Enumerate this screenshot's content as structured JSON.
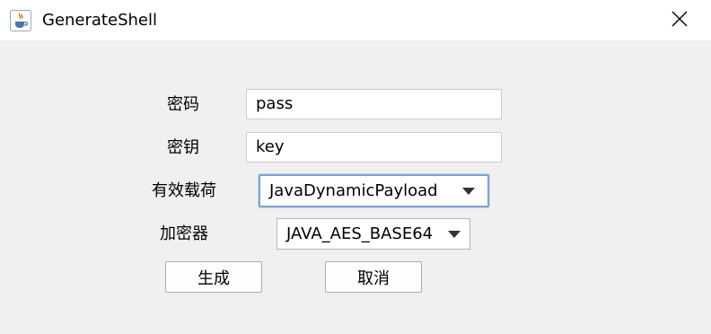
{
  "window": {
    "title": "GenerateShell",
    "icon": "java-cup-icon",
    "close_icon": "close-icon"
  },
  "form": {
    "password": {
      "label": "密码",
      "value": "pass"
    },
    "secret_key": {
      "label": "密钥",
      "value": "key"
    },
    "payload": {
      "label": "有效载荷",
      "selected": "JavaDynamicPayload"
    },
    "cryption": {
      "label": "加密器",
      "selected": "JAVA_AES_BASE64"
    }
  },
  "buttons": {
    "generate": "生成",
    "cancel": "取消"
  },
  "colors": {
    "background": "#f0f0f0",
    "titlebar": "#ffffff",
    "focus_border": "#7da2ce"
  }
}
